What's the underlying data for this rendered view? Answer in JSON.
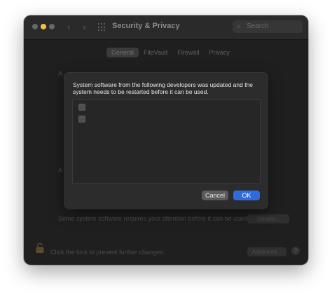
{
  "window": {
    "title": "Security & Privacy",
    "search_placeholder": "Search",
    "back_glyph": "‹",
    "forward_glyph": "›",
    "search_glyph": "⌕"
  },
  "tabs": [
    {
      "label": "General",
      "active": true
    },
    {
      "label": "FileVault",
      "active": false
    },
    {
      "label": "Firewall",
      "active": false
    },
    {
      "label": "Privacy",
      "active": false
    }
  ],
  "background": {
    "row1_fragment": "A",
    "row2_fragment": "A",
    "system_software_text": "Some system software requires your attention before it can be used.",
    "details_button": "Details...",
    "lock_text": "Click the lock to prevent further changes.",
    "advanced_button": "Advanced...",
    "help_glyph": "?"
  },
  "dialog": {
    "message": "System software from the following developers was updated and the system needs to be restarted before it can be used.",
    "items": [
      {
        "label": "",
        "checked": false
      },
      {
        "label": "",
        "checked": false
      }
    ],
    "cancel_label": "Cancel",
    "ok_label": "OK"
  },
  "colors": {
    "accent": "#2f6bde",
    "window_bg": "#1f1f1f",
    "dialog_bg": "#2c2c2c"
  },
  "icons": [
    "close-light",
    "minimize-light",
    "zoom-light",
    "back-arrow-icon",
    "forward-arrow-icon",
    "grid-icon",
    "search-icon",
    "lock-icon",
    "help-icon"
  ]
}
